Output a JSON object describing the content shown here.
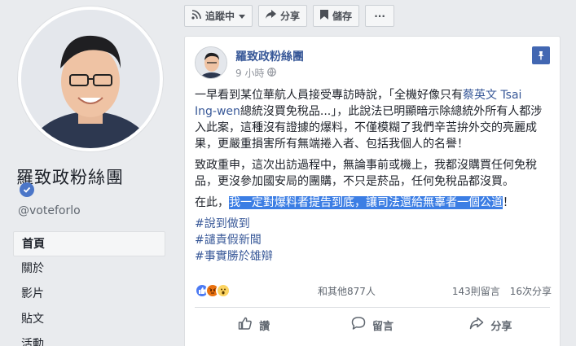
{
  "page": {
    "name": "羅致政粉絲團",
    "username": "@voteforlo"
  },
  "nav": {
    "items": [
      {
        "label": "首頁",
        "active": true
      },
      {
        "label": "關於",
        "active": false
      },
      {
        "label": "影片",
        "active": false
      },
      {
        "label": "貼文",
        "active": false
      },
      {
        "label": "活動",
        "active": false
      }
    ]
  },
  "actions": {
    "follow_label": "追蹤中",
    "share_label": "分享",
    "save_label": "儲存",
    "more_label": "···"
  },
  "post": {
    "author": "羅致政粉絲團",
    "time": "9 小時",
    "p1_before": "一早看到某位華航人員接受專訪時說，「全機好像只有",
    "p1_mention": "蔡英文 Tsai Ing-wen",
    "p1_after": "總統沒買免稅品...」，此說法已明顯暗示除總統外所有人都涉入此案，這種沒有證據的爆料，不僅模糊了我們辛苦拚外交的亮麗成果，更嚴重損害所有無端捲入者、包括我個人的名譽！",
    "p2": "致政重申，這次出訪過程中，無論事前或機上，我都沒購買任何免稅品，更沒參加國安局的團購，不只是菸品，任何免稅品都沒買。",
    "p3_before": "在此，",
    "p3_highlight": "我一定對爆料者提告到底，讓司法還給無辜者一個公道",
    "p3_after": "！",
    "hashtags": [
      "#說到做到",
      "#譴責假新聞",
      "#事實勝於雄辯"
    ]
  },
  "reactions": {
    "others": "和其他877人",
    "comments": "143則留言",
    "shares": "16次分享"
  },
  "footer": {
    "like_label": "讚",
    "comment_label": "留言",
    "share_label": "分享"
  },
  "colors": {
    "brand": "#4267b2",
    "link": "#385898",
    "highlight": "#3c7ee4"
  }
}
